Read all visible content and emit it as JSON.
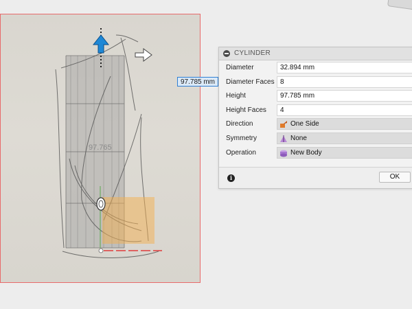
{
  "panel": {
    "title": "CYLINDER",
    "rows": [
      {
        "label": "Diameter",
        "value": "32.894 mm"
      },
      {
        "label": "Diameter Faces",
        "value": "8"
      },
      {
        "label": "Height",
        "value": "97.785 mm"
      },
      {
        "label": "Height Faces",
        "value": "4"
      },
      {
        "label": "Direction",
        "value": "One Side",
        "icon": "one-side-icon"
      },
      {
        "label": "Symmetry",
        "value": "None",
        "icon": "symmetry-icon"
      },
      {
        "label": "Operation",
        "value": "New Body",
        "icon": "new-body-icon"
      }
    ],
    "ok_label": "OK",
    "info_icon": "info-icon"
  },
  "viewport": {
    "dimension_input": "97.785 mm",
    "watermark_text": "97.765",
    "icons": [
      "move-arrow-icon",
      "direction-arrow-icon",
      "axis-manipulator-icon"
    ]
  },
  "colors": {
    "accent_blue": "#1e88d6",
    "frame_red": "#e86a6a",
    "preview_orange": "#f3b04f"
  }
}
